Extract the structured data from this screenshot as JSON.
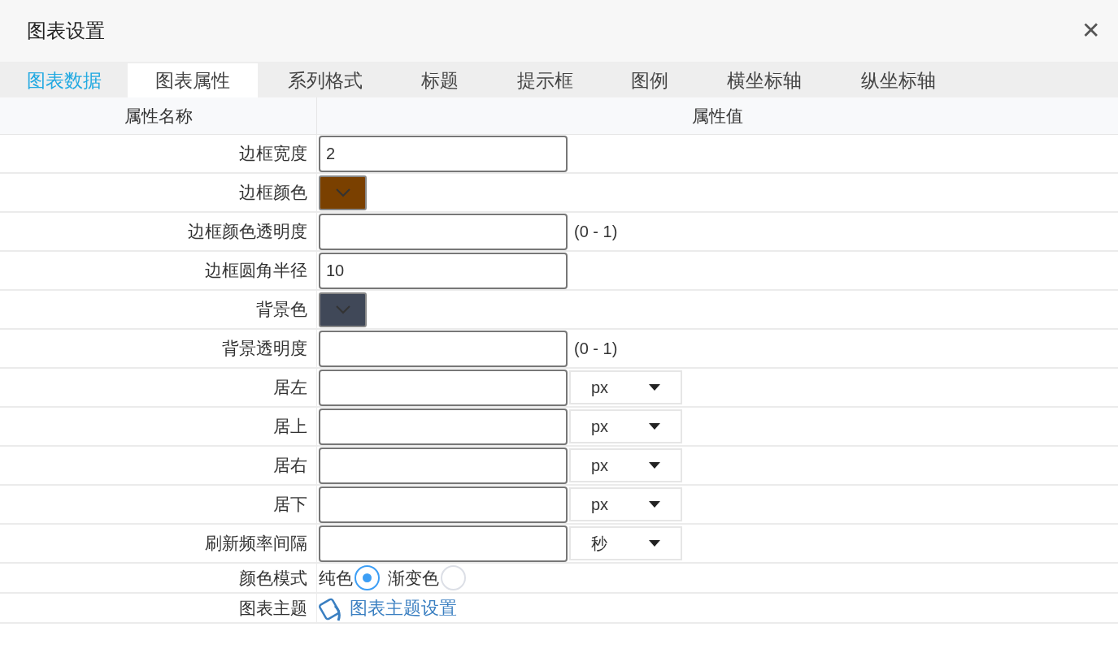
{
  "window": {
    "title": "图表设置",
    "close": "✕"
  },
  "tabs": [
    {
      "label": "图表数据",
      "selected": false,
      "hovered": true
    },
    {
      "label": "图表属性",
      "selected": true,
      "hovered": false
    },
    {
      "label": "系列格式",
      "selected": false,
      "hovered": false
    },
    {
      "label": "标题",
      "selected": false,
      "hovered": false
    },
    {
      "label": "提示框",
      "selected": false,
      "hovered": false
    },
    {
      "label": "图例",
      "selected": false,
      "hovered": false
    },
    {
      "label": "横坐标轴",
      "selected": false,
      "hovered": false
    },
    {
      "label": "纵坐标轴",
      "selected": false,
      "hovered": false
    }
  ],
  "table": {
    "columns": [
      "属性名称",
      "属性值"
    ],
    "rows": [
      {
        "kind": "text",
        "name": "边框宽度",
        "value": "2"
      },
      {
        "kind": "color",
        "name": "边框颜色",
        "color": "#7a4000"
      },
      {
        "kind": "text",
        "name": "边框颜色透明度",
        "value": "",
        "hint": "(0 - 1)"
      },
      {
        "kind": "text",
        "name": "边框圆角半径",
        "value": "10"
      },
      {
        "kind": "color",
        "name": "背景色",
        "color": "#404858"
      },
      {
        "kind": "text",
        "name": "背景透明度",
        "value": "",
        "hint": "(0 - 1)"
      },
      {
        "kind": "unit",
        "name": "居左",
        "value": "",
        "unit": "px"
      },
      {
        "kind": "unit",
        "name": "居上",
        "value": "",
        "unit": "px"
      },
      {
        "kind": "unit",
        "name": "居右",
        "value": "",
        "unit": "px"
      },
      {
        "kind": "unit",
        "name": "居下",
        "value": "",
        "unit": "px"
      },
      {
        "kind": "unit",
        "name": "刷新频率间隔",
        "value": "",
        "unit": "秒"
      },
      {
        "kind": "radio",
        "name": "颜色模式",
        "options": [
          {
            "label": "纯色",
            "selected": true
          },
          {
            "label": "渐变色",
            "selected": false
          }
        ]
      },
      {
        "kind": "link",
        "name": "图表主题",
        "label": "图表主题设置"
      }
    ]
  }
}
